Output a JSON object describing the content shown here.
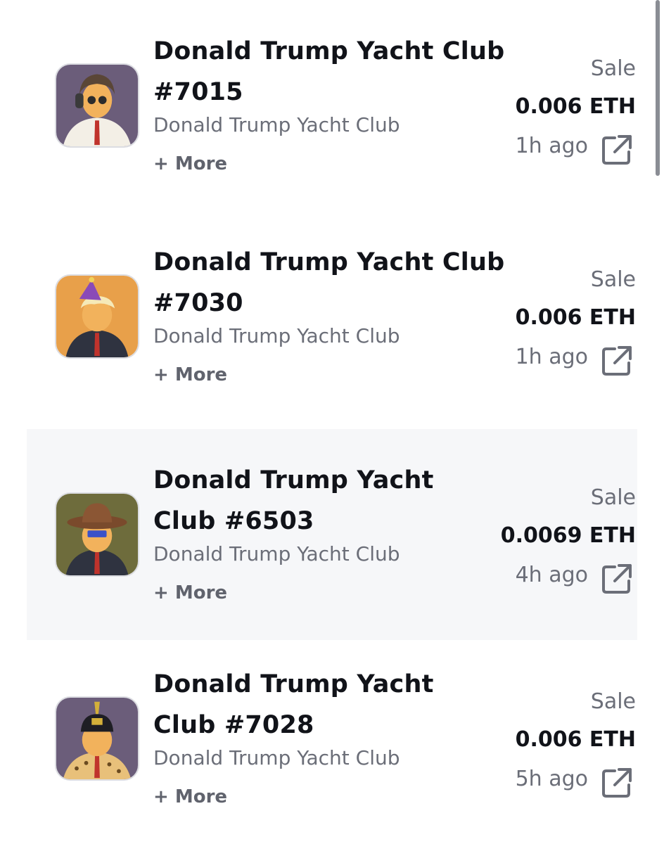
{
  "sales": [
    {
      "title": "Donald Trump Yacht Club #7015",
      "collection": "Donald Trump Yacht Club",
      "more": "+ More",
      "type": "Sale",
      "price": "0.006 ETH",
      "time": "1h ago",
      "thumb_bg": "#6b5d7a",
      "highlighted": false
    },
    {
      "title": "Donald Trump Yacht Club #7030",
      "collection": "Donald Trump Yacht Club",
      "more": "+ More",
      "type": "Sale",
      "price": "0.006 ETH",
      "time": "1h ago",
      "thumb_bg": "#e8a04a",
      "highlighted": false
    },
    {
      "title": "Donald Trump Yacht Club #6503",
      "collection": "Donald Trump Yacht Club",
      "more": "+ More",
      "type": "Sale",
      "price": "0.0069 ETH",
      "time": "4h ago",
      "thumb_bg": "#6e6c3c",
      "highlighted": true
    },
    {
      "title": "Donald Trump Yacht Club #7028",
      "collection": "Donald Trump Yacht Club",
      "more": "+ More",
      "type": "Sale",
      "price": "0.006 ETH",
      "time": "5h ago",
      "thumb_bg": "#6b5d7a",
      "highlighted": false
    }
  ],
  "colors": {
    "title": "#111319",
    "muted": "#6b6e78",
    "highlight_row": "#f6f7f9"
  },
  "icons": {
    "external_link": "external-link-icon",
    "avatar": "nft-avatar"
  }
}
